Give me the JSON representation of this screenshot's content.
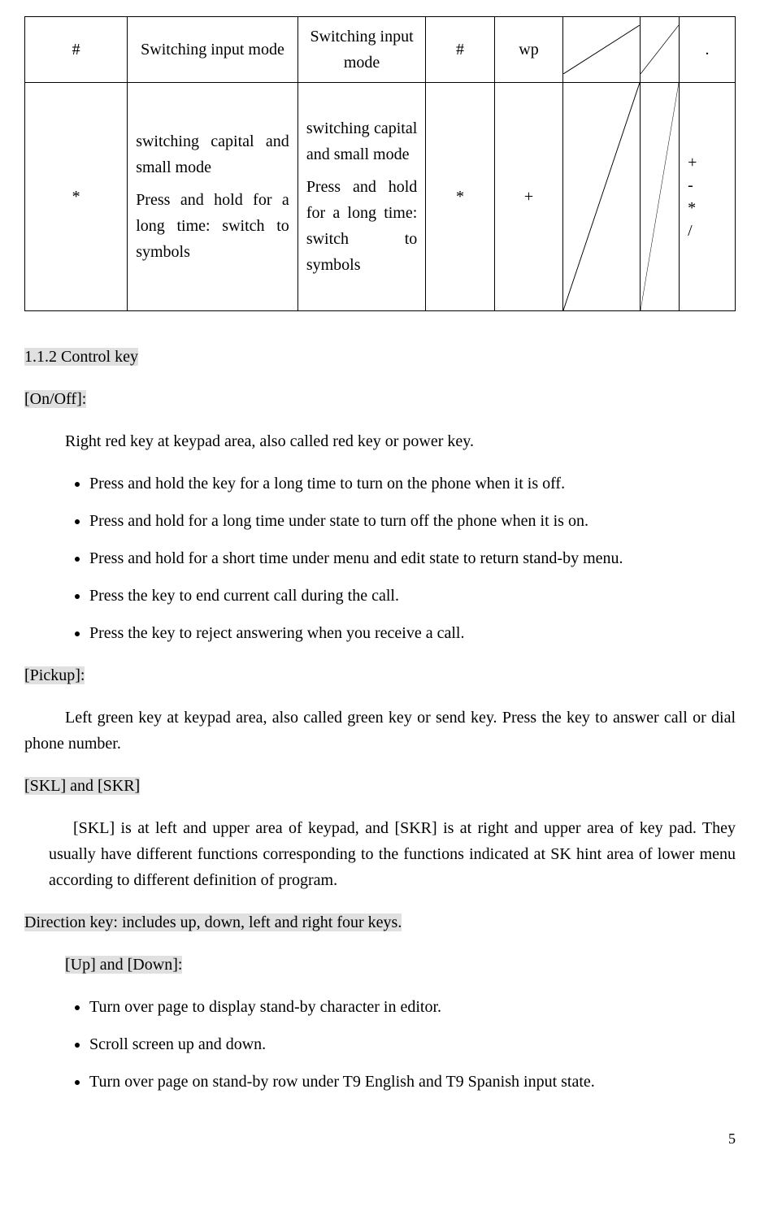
{
  "table": {
    "row1": {
      "c1": "#",
      "c2": "Switching input mode",
      "c3": "Switching input mode",
      "c4": "#",
      "c5": "wp",
      "c8": "."
    },
    "row2": {
      "c1": "*",
      "c2a": "switching capital and small mode",
      "c2b": "Press and hold for a long time: switch to symbols",
      "c3a": "switching capital and small mode",
      "c3b": "Press and hold for a long time: switch to symbols",
      "c4": "*",
      "c5": "+",
      "c8": "+\n-\n*\n/"
    }
  },
  "section112": "1.1.2 Control key",
  "onoff_label": "[On/Off]:",
  "onoff_desc": "Right red key at keypad area, also called red key or power key.",
  "onoff_bullets": [
    "Press and hold the key for a long time to turn on the phone when it is off.",
    "Press and hold for a long time under state to turn off the phone when it is on.",
    "Press and hold for a short time under menu and edit state to return stand-by menu.",
    "Press the key to end current call during the call.",
    "Press the key to reject answering when you receive a call."
  ],
  "pickup_label": "[Pickup]:",
  "pickup_desc": "Left green key at keypad area, also called green key or send key. Press the key to answer call or dial phone number.",
  "skl_label": "[SKL] and [SKR]",
  "skl_desc": "[SKL] is at left and upper area of keypad, and [SKR] is at right and upper area of key pad. They usually have different functions corresponding to the functions indicated at SK hint area of lower menu according to different definition of program.",
  "dir_label": "Direction key: includes up, down, left and right four keys.",
  "updown_label": "[Up] and [Down]:",
  "updown_bullets": [
    "Turn over page to display stand-by character in editor.",
    "Scroll screen up and down.",
    "Turn over page on stand-by row under T9 English and T9 Spanish input state."
  ],
  "page_number": "5"
}
